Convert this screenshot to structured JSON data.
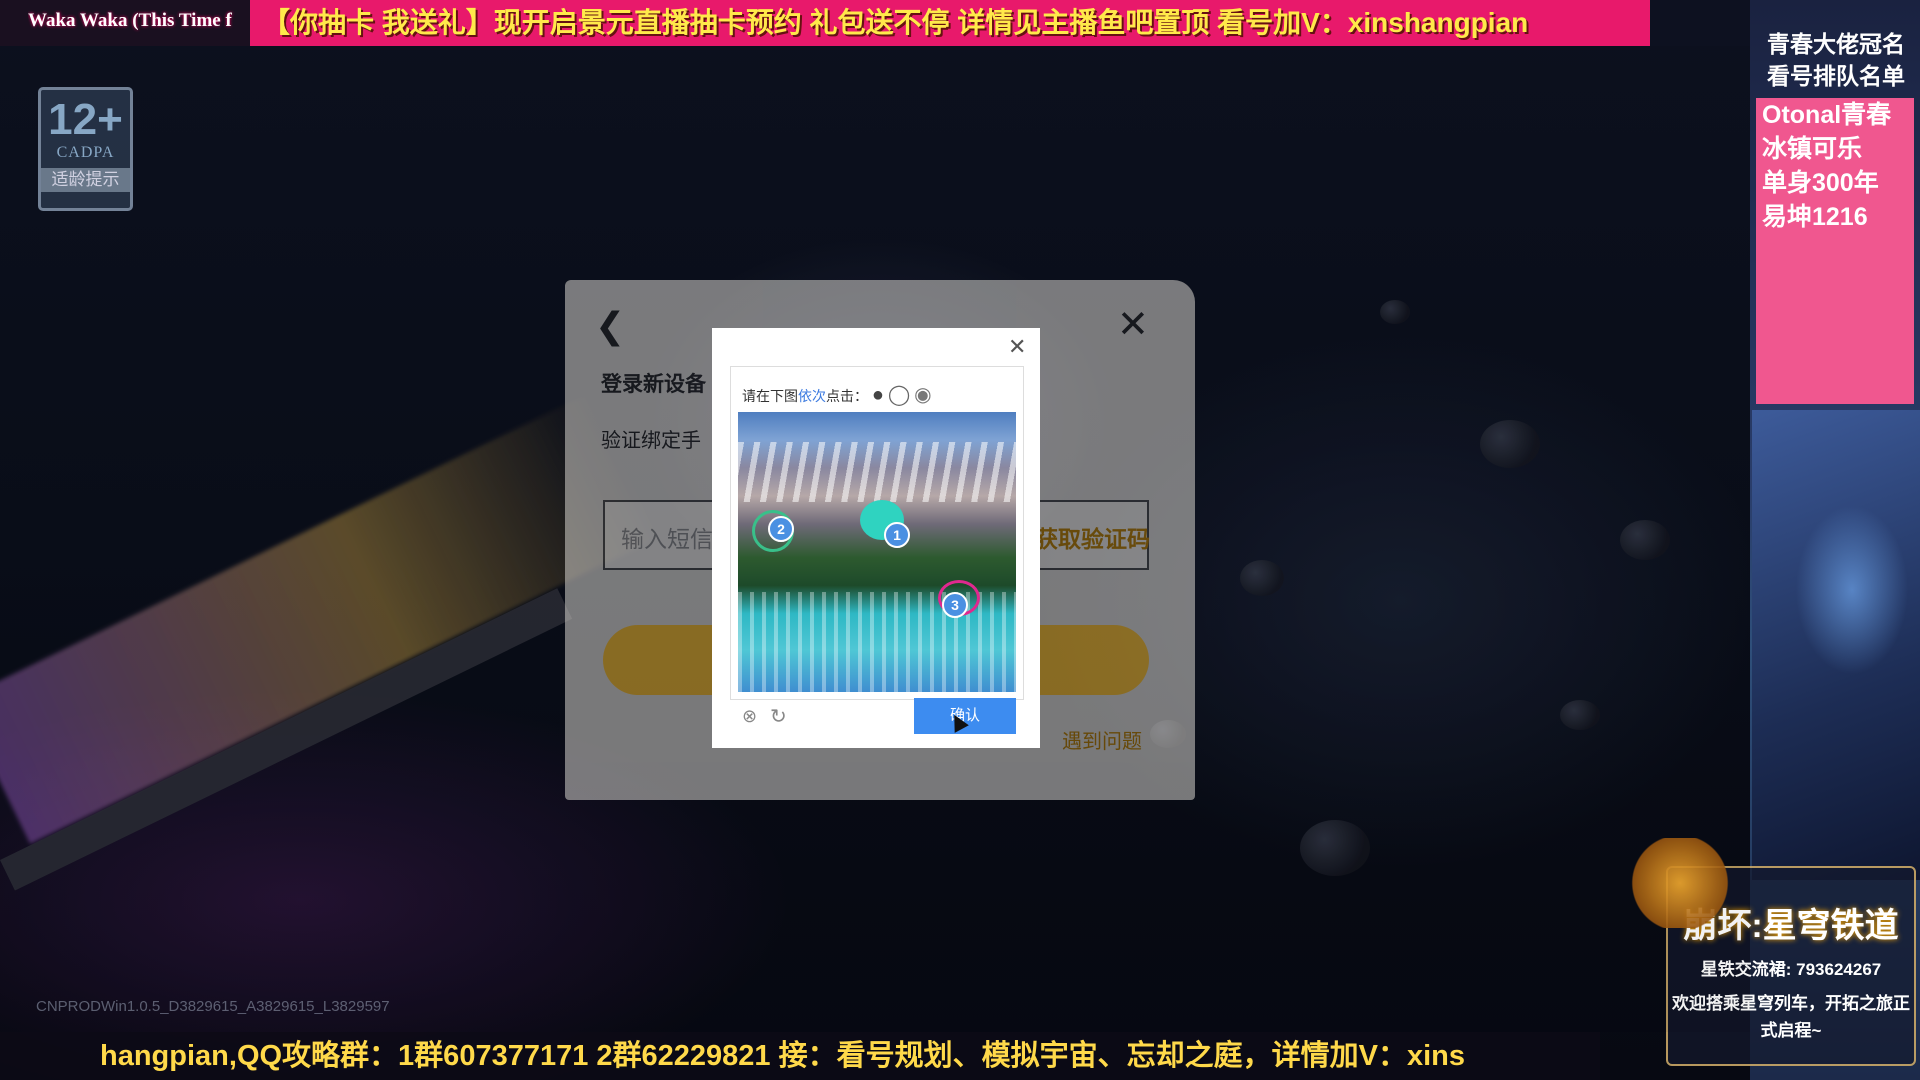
{
  "banner": {
    "song": "Waka Waka (This Time f",
    "promo": "【你抽卡 我送礼】现开启景元直播抽卡预约 礼包送不停   详情见主播鱼吧置顶   看号加V：xinshangpian"
  },
  "age_rating": {
    "number": "12+",
    "org": "CADPA",
    "label": "适龄提示"
  },
  "sidebar": {
    "title": "青春大佬冠名看号排队名单",
    "names": [
      "Otonal青春",
      "冰镇可乐",
      "单身300年",
      "易坤1216"
    ]
  },
  "hsr": {
    "logo": "崩坏:星穹铁道",
    "group": "星铁交流裙: 793624267",
    "welcome": "欢迎搭乘星穹列车，开拓之旅正式启程~"
  },
  "ticker": "hangpian,QQ攻略群：1群607377171 2群62229821      接：看号规划、模拟宇宙、忘却之庭，详情加V：xins",
  "version": "CNPRODWin1.0.5_D3829615_A3829615_L3829597",
  "login": {
    "title": "登录新设备",
    "subtitle": "验证绑定手",
    "input_placeholder": "输入短信",
    "get_code": "获取验证码",
    "help": "遇到问题"
  },
  "captcha": {
    "prompt_pre": "请在下图",
    "prompt_hl": "依次",
    "prompt_post": "点击：",
    "confirm": "确认",
    "markers": [
      "1",
      "2",
      "3"
    ]
  },
  "colors": {
    "promo_bg": "#e8196b",
    "promo_text": "#ffe94a",
    "sidebar_list": "#f0578f",
    "confirm": "#3d8cf0"
  }
}
